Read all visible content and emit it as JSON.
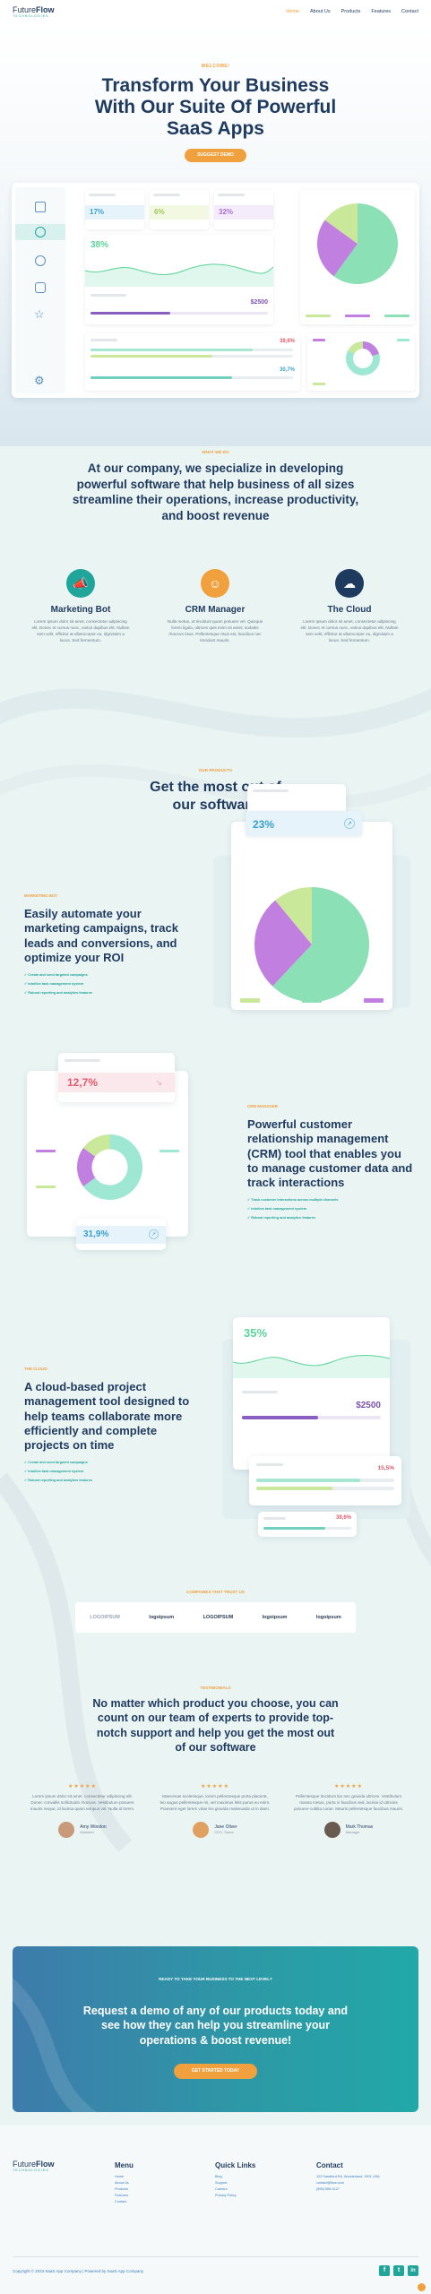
{
  "brand": {
    "name_part1": "Future",
    "name_part2": "Flow",
    "tagline": "TECHNOLOGIES"
  },
  "nav": {
    "items": [
      "Home",
      "About Us",
      "Products",
      "Features",
      "Contact"
    ]
  },
  "hero": {
    "eyebrow": "WELCOME!",
    "title": "Transform Your Business With Our Suite Of Powerful SaaS Apps",
    "cta": "SUGGEST DEMO"
  },
  "dashboard": {
    "stats": [
      "17%",
      "6%",
      "32%"
    ],
    "big_stat": "38%",
    "amount": "$2500",
    "pct_red": "39,6%",
    "pct_teal": "30,7%",
    "chart_data": {
      "type": "pie",
      "values": [
        60,
        25,
        15
      ],
      "colors": [
        "#8be0b6",
        "#c17fe0",
        "#c9e89a"
      ]
    }
  },
  "about": {
    "eyebrow": "WHAT WE DO",
    "title": "At our company, we specialize in developing powerful software that help business of all sizes streamline their operations, increase productivity, and boost revenue",
    "features": [
      {
        "title": "Marketing Bot",
        "text": "Lorem ipsum dolor sit amet, consectetur adipiscing elit. Donec et cursus nunc, varius dapibus elit. Nullam sem velit, efficitur at ullamcorper eu, dignissim a lacus. Sed fermentum."
      },
      {
        "title": "CRM Manager",
        "text": "Nulla metus, at tincidunt quam posuere vel. Quisque lorem ligula, ultrices quis enim sit amet, sodales rhoncus risus. Pellentesque risus est, faucibus nec tincidunt mauris."
      },
      {
        "title": "The Cloud",
        "text": "Lorem ipsum dolor sit amet, consectetur adipiscing elit. Donec et cursus nunc, varius dapibus elit. Nullam sem velit, efficitur at ullamcorper eu, dignissim a lacus. Sed fermentum."
      }
    ]
  },
  "products": {
    "eyebrow": "OUR PRODUCTS",
    "title": "Get the most out of our software"
  },
  "marketing": {
    "eyebrow": "MARKETING BOT",
    "title": "Easily automate your marketing campaigns, track leads and conversions, and optimize your ROI",
    "bullets": [
      "Create and send targeted campaigns",
      "Intuitive task management system",
      "Robust reporting and analytics features"
    ],
    "stat": "23%",
    "chart_data": {
      "type": "pie",
      "values": [
        62,
        27,
        11
      ],
      "colors": [
        "#8be0b6",
        "#c17fe0",
        "#c9e89a"
      ]
    }
  },
  "crm": {
    "eyebrow": "CRM MANAGER",
    "title": "Powerful customer relationship management (CRM) tool that enables you to manage customer data and track interactions",
    "bullets": [
      "Track customer interactions across multiple channels",
      "Intuitive task management system",
      "Robust reporting and analytics features"
    ],
    "stat_red": "12,7%",
    "stat_teal": "31,9%",
    "chart_data": {
      "type": "donut",
      "values": [
        65,
        20,
        15
      ],
      "colors": [
        "#9ee8d3",
        "#c17fe0",
        "#c9e89a"
      ]
    }
  },
  "cloud": {
    "eyebrow": "THE CLOUD",
    "title": "A cloud-based project management tool designed to help teams collaborate more efficiently and complete projects on time",
    "bullets": [
      "Create and send targeted campaigns",
      "Intuitive task management system",
      "Robust reporting and analytics features"
    ],
    "stat": "35%",
    "amount": "$2500",
    "pct1": "15,5%",
    "pct2": "39,6%"
  },
  "partners": {
    "eyebrow": "COMPANIES THAT TRUST US",
    "logos": [
      "LOGOIPSUM",
      "logoipsum",
      "LOGOIPSUM",
      "logoipsum",
      "logoipsum"
    ]
  },
  "testimonials": {
    "eyebrow": "TESTIMONIALS",
    "title": "No matter which product you choose, you can count on our team of experts to provide top-notch support and help you get the most out of our software",
    "items": [
      {
        "stars": "★★★★★",
        "quote": "Lorem ipsum dolor sit amet, consectetur adipiscing elit. Donec convallis sollicitudin rhoncus. Vestibulum posuere mauris neque, id lacinia quam tempus vel. Nulla id lorem.",
        "name": "Amy Winston",
        "role": "Marketer"
      },
      {
        "stars": "★★★★★",
        "quote": "Maecenas scelerisque, lorem pellentesque porta placerat, leo augue pellentesque mi, vel maximus felis purus eu enim. Praesent eget lorem vitae leo gravida malesuada ut in diam.",
        "name": "Jane Oliver",
        "role": "CEO, Some"
      },
      {
        "stars": "★★★★★",
        "quote": "Pellentesque tincidunt leo nec gravida ultrices. Vestibulum massa metus, porta in faucibus sed, lacinia id ultricies posuere cubilia curae. Mauris pellentesque faucibus mauris.",
        "name": "Mark Thomas",
        "role": "Manager"
      }
    ]
  },
  "cta_band": {
    "eyebrow": "READY TO TAKE YOUR BUSINESS TO THE NEXT LEVEL?",
    "title": "Request a demo of any of our products today and see how they can help you streamline your operations & boost revenue!",
    "button": "GET STARTED TODAY"
  },
  "footer": {
    "menu_title": "Menu",
    "menu": [
      "Home",
      "About Us",
      "Products",
      "Features",
      "Contact"
    ],
    "links_title": "Quick Links",
    "links": [
      "Blog",
      "Support",
      "Careers",
      "Privacy Policy"
    ],
    "contact_title": "Contact",
    "contact": [
      "123 Sandford Rd, Wonderland, 9201 USA",
      "contact@flow.com",
      "(555) 555-0127"
    ],
    "copyright": "Copyright © 2023 SaaS App Company | Powered by SaaS App Company"
  }
}
